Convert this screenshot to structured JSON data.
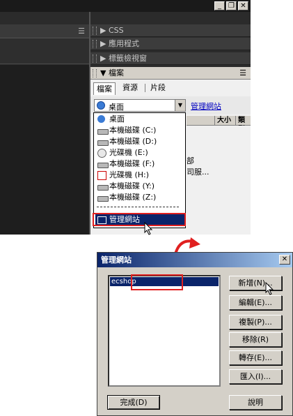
{
  "panels": {
    "css": "CSS",
    "app_program": "應用程式",
    "tag_inspector": "標籤檢視窗",
    "files": "檔案"
  },
  "file_tabs": [
    "檔案",
    "資源",
    "片段"
  ],
  "site_combo": {
    "value": "桌面",
    "arrow": "▼"
  },
  "manage_sites_link": "管理網站",
  "columns": [
    "大小",
    "類型"
  ],
  "behind_text": [
    "部",
    "司服..."
  ],
  "dropdown": {
    "items": [
      {
        "label": "桌面",
        "icon": "desktop-icon"
      },
      {
        "label": "本機磁碟 (C:)",
        "icon": "hard-drive-icon"
      },
      {
        "label": "本機磁碟 (D:)",
        "icon": "hard-drive-icon"
      },
      {
        "label": "光碟機 (E:)",
        "icon": "cd-drive-icon"
      },
      {
        "label": "本機磁碟 (F:)",
        "icon": "hard-drive-icon"
      },
      {
        "label": "光碟機 (H:)",
        "icon": "removable-drive-icon"
      },
      {
        "label": "本機磁碟 (Y:)",
        "icon": "hard-drive-icon"
      },
      {
        "label": "本機磁碟 (Z:)",
        "icon": "hard-drive-icon"
      }
    ],
    "separator": "———————————",
    "manage": "管理網站"
  },
  "dialog": {
    "title": "管理網站",
    "close": "✕",
    "sites": [
      "ecshop"
    ],
    "buttons": {
      "new": "新增(N)...",
      "edit": "編輯(E)...",
      "duplicate": "複製(P)...",
      "remove": "移除(R)",
      "export": "轉存(E)...",
      "import": "匯入(I)...",
      "done": "完成(D)",
      "help": "說明"
    }
  },
  "colors": {
    "highlight_box": "#e02020",
    "selection": "#0a246a",
    "link": "#0000c0"
  }
}
